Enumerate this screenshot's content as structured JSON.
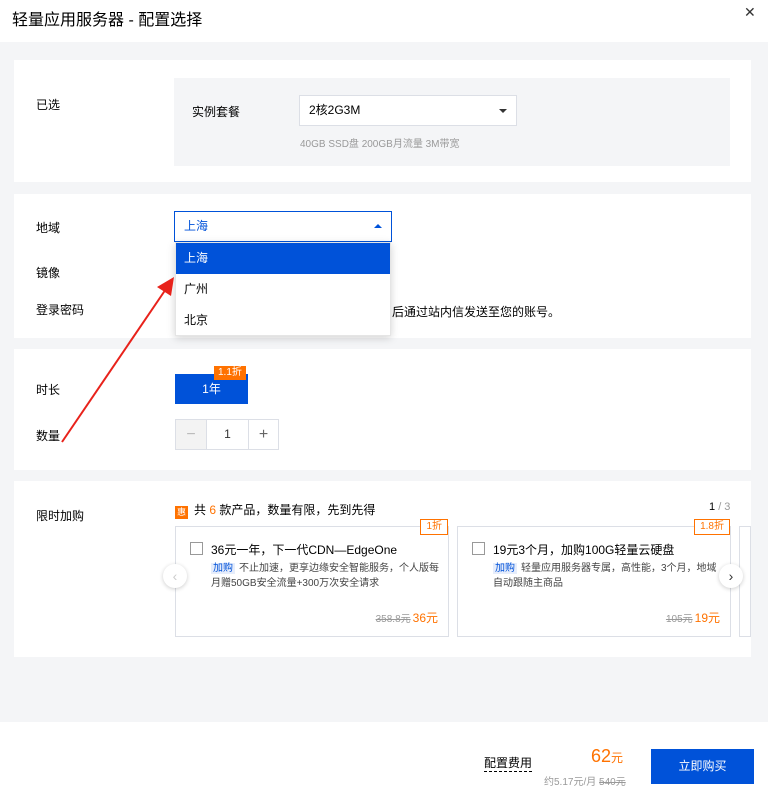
{
  "header": {
    "title": "轻量应用服务器 - 配置选择",
    "close_icon": "close-icon"
  },
  "selected": {
    "label": "已选",
    "package_label": "实例套餐",
    "package_value": "2核2G3M",
    "package_desc": "40GB SSD盘 200GB月流量 3M带宽"
  },
  "config": {
    "region_label": "地域",
    "region_value": "上海",
    "region_options": [
      "上海",
      "广州",
      "北京"
    ],
    "image_label": "镜像",
    "password_label": "登录密码",
    "password_hint": "后通过站内信发送至您的账号。"
  },
  "purchase": {
    "duration_label": "时长",
    "duration_value": "1年",
    "duration_discount": "1.1折",
    "quantity_label": "数量",
    "quantity_minus": "−",
    "quantity_value": "1",
    "quantity_plus": "+"
  },
  "promo": {
    "label": "限时加购",
    "icon_text": "惠",
    "header_prefix": "共",
    "header_count": "6",
    "header_suffix": "款产品，数量有限，先到先得",
    "page_current": "1",
    "page_total": "/ 3",
    "prev_icon": "‹",
    "next_icon": "›",
    "cards": [
      {
        "tag": "1折",
        "title": "36元一年，下一代CDN—EdgeOne",
        "badge": "加购",
        "desc": "不止加速，更享边缘安全智能服务，个人版每月赠50GB安全流量+300万次安全请求",
        "orig_price": "358.8元",
        "price": "36元"
      },
      {
        "tag": "1.8折",
        "title": "19元3个月，加购100G轻量云硬盘",
        "badge": "加购",
        "desc": "轻量应用服务器专属，高性能，3个月，地域自动跟随主商品",
        "orig_price": "105元",
        "price": "19元"
      }
    ]
  },
  "footer": {
    "fee_label": "配置费用",
    "fee_amount": "62",
    "fee_unit": "元",
    "fee_monthly": "约5.17元/月",
    "fee_orig": "540元",
    "buy_label": "立即购买"
  },
  "colors": {
    "primary": "#0052d9",
    "accent": "#ff7200",
    "annotation_arrow": "#e8221b"
  }
}
